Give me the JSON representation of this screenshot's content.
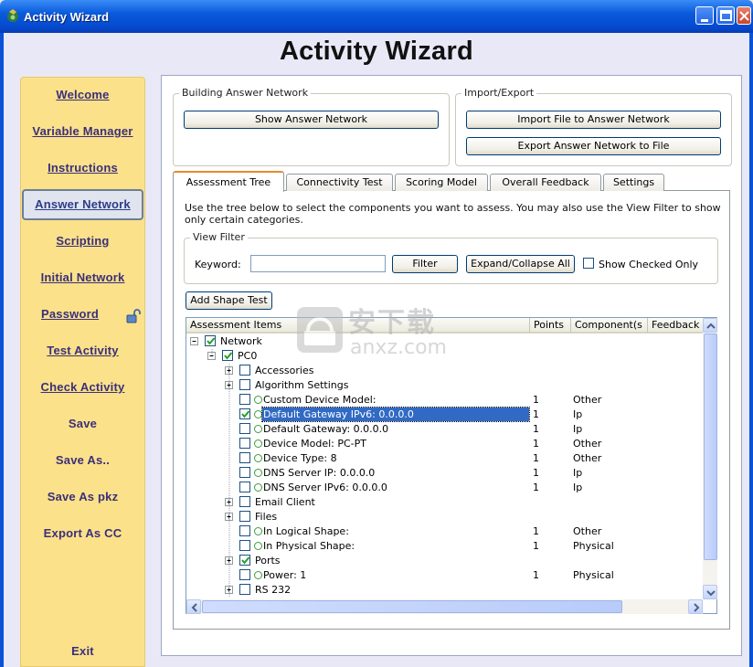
{
  "window": {
    "title": "Activity Wizard",
    "heading": "Activity Wizard",
    "titlebar_color": "#0a5bdc"
  },
  "sidebar": {
    "background": "#fbe18a",
    "items": [
      {
        "label": "Welcome"
      },
      {
        "label": "Variable Manager"
      },
      {
        "label": "Instructions"
      },
      {
        "label": "Answer Network",
        "active": true
      },
      {
        "label": "Scripting"
      },
      {
        "label": "Initial Network"
      },
      {
        "label": "Password"
      },
      {
        "label": "Test Activity"
      },
      {
        "label": "Check Activity"
      },
      {
        "label": "Save"
      },
      {
        "label": "Save As.."
      },
      {
        "label": "Save As pkz"
      },
      {
        "label": "Export As CC"
      },
      {
        "label": "Exit"
      }
    ]
  },
  "building": {
    "group_label": "Building Answer Network",
    "show_button": "Show Answer Network"
  },
  "import_export": {
    "group_label": "Import/Export",
    "import_button": "Import File to Answer Network",
    "export_button": "Export Answer Network to File"
  },
  "tabs": [
    {
      "label": "Assessment Tree",
      "active": true
    },
    {
      "label": "Connectivity Test"
    },
    {
      "label": "Scoring Model"
    },
    {
      "label": "Overall Feedback"
    },
    {
      "label": "Settings"
    }
  ],
  "assessment": {
    "description": "Use the tree below to select the components you want to assess. You may also use the View Filter to show only certain categories.",
    "view_filter": {
      "group_label": "View Filter",
      "keyword_label": "Keyword:",
      "keyword_value": "",
      "filter_button": "Filter",
      "expand_button": "Expand/Collapse All",
      "show_checked_label": "Show Checked Only",
      "show_checked": false
    },
    "add_shape_button": "Add Shape Test",
    "columns": [
      "Assessment Items",
      "Points",
      "Component(s",
      "Feedback"
    ],
    "rows": [
      {
        "label": "Network",
        "points": "",
        "component": "",
        "checked": true,
        "level": 0,
        "expand": "minus"
      },
      {
        "label": "PC0",
        "points": "",
        "component": "",
        "checked": true,
        "level": 1,
        "expand": "minus"
      },
      {
        "label": "Accessories",
        "points": "",
        "component": "",
        "checked": false,
        "level": 2,
        "expand": "plus"
      },
      {
        "label": "Algorithm Settings",
        "points": "",
        "component": "",
        "checked": false,
        "level": 2,
        "expand": "plus"
      },
      {
        "label": "Custom Device Model:",
        "points": "1",
        "component": "Other",
        "checked": false,
        "level": 2,
        "leaf": true
      },
      {
        "label": "Default Gateway IPv6: 0.0.0.0",
        "points": "1",
        "component": "Ip",
        "checked": true,
        "level": 2,
        "leaf": true,
        "selected": true
      },
      {
        "label": "Default Gateway: 0.0.0.0",
        "points": "1",
        "component": "Ip",
        "checked": false,
        "level": 2,
        "leaf": true
      },
      {
        "label": "Device Model: PC-PT",
        "points": "1",
        "component": "Other",
        "checked": false,
        "level": 2,
        "leaf": true
      },
      {
        "label": "Device Type: 8",
        "points": "1",
        "component": "Other",
        "checked": false,
        "level": 2,
        "leaf": true
      },
      {
        "label": "DNS Server IP: 0.0.0.0",
        "points": "1",
        "component": "Ip",
        "checked": false,
        "level": 2,
        "leaf": true
      },
      {
        "label": "DNS Server IPv6: 0.0.0.0",
        "points": "1",
        "component": "Ip",
        "checked": false,
        "level": 2,
        "leaf": true
      },
      {
        "label": "Email Client",
        "points": "",
        "component": "",
        "checked": false,
        "level": 2,
        "expand": "plus"
      },
      {
        "label": "Files",
        "points": "",
        "component": "",
        "checked": false,
        "level": 2,
        "expand": "plus"
      },
      {
        "label": "In Logical Shape:",
        "points": "1",
        "component": "Other",
        "checked": false,
        "level": 2,
        "leaf": true
      },
      {
        "label": "In Physical Shape:",
        "points": "1",
        "component": "Physical",
        "checked": false,
        "level": 2,
        "leaf": true
      },
      {
        "label": "Ports",
        "points": "",
        "component": "",
        "checked": true,
        "level": 2,
        "expand": "plus"
      },
      {
        "label": "Power: 1",
        "points": "1",
        "component": "Physical",
        "checked": false,
        "level": 2,
        "leaf": true
      },
      {
        "label": "RS 232",
        "points": "",
        "component": "",
        "checked": false,
        "level": 2,
        "expand": "plus"
      }
    ]
  },
  "watermark": {
    "cn_text": "安下载",
    "domain_text": "anxz.com"
  }
}
